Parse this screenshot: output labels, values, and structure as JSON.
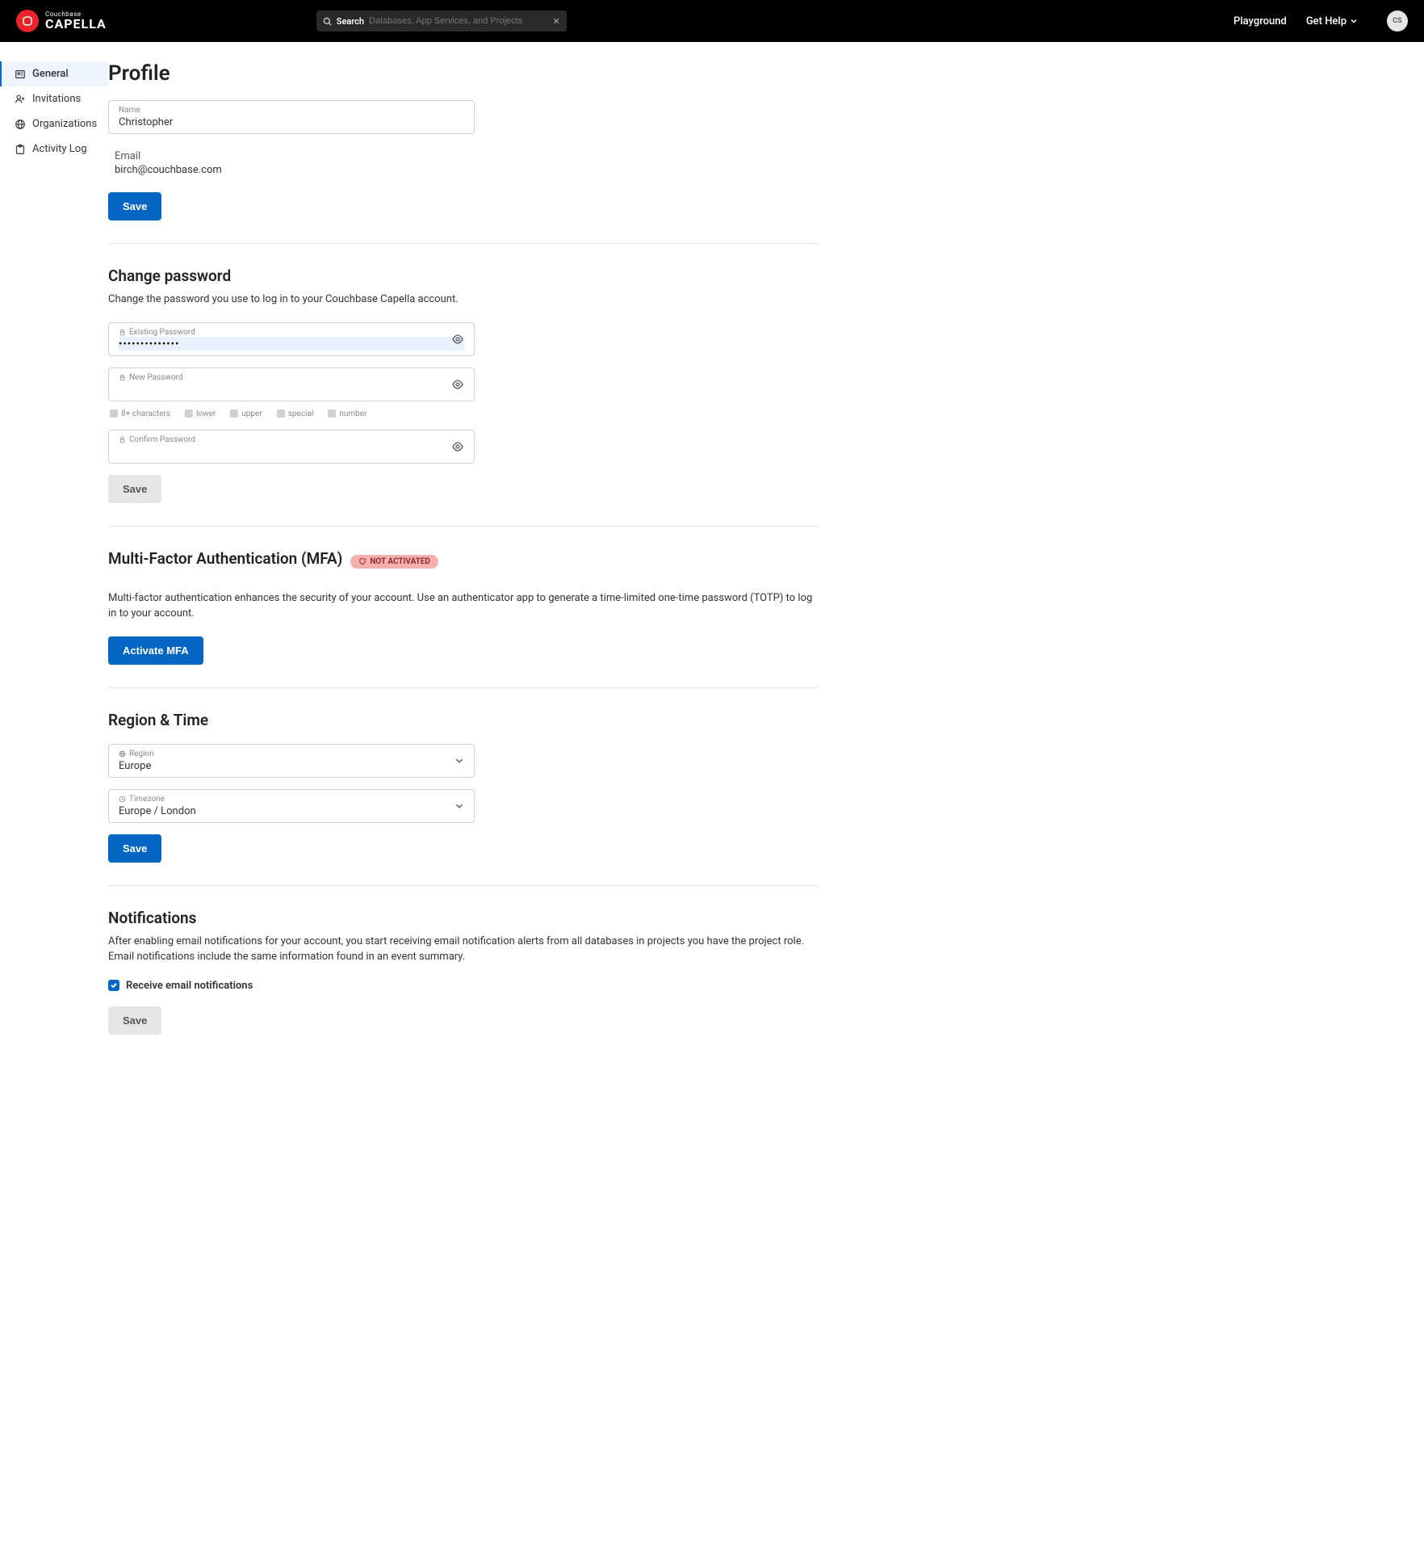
{
  "header": {
    "logo_small": "Couchbase",
    "logo_big": "CAPELLA",
    "search_label": "Search",
    "search_placeholder": "Databases, App Services, and Projects",
    "playground": "Playground",
    "get_help": "Get Help",
    "avatar_initials": "CS"
  },
  "sidebar": {
    "items": [
      {
        "label": "General",
        "active": true
      },
      {
        "label": "Invitations",
        "active": false
      },
      {
        "label": "Organizations",
        "active": false
      },
      {
        "label": "Activity Log",
        "active": false
      }
    ]
  },
  "profile": {
    "title": "Profile",
    "name_label": "Name",
    "name_value": "Christopher",
    "email_label": "Email",
    "email_value": "birch@couchbase.com",
    "save": "Save"
  },
  "password": {
    "title": "Change password",
    "desc": "Change the password you use to log in to your Couchbase Capella account.",
    "existing_label": "Existing Password",
    "existing_value": "••••••••••••••",
    "new_label": "New Password",
    "confirm_label": "Confirm Password",
    "reqs": [
      "8+ characters",
      "lower",
      "upper",
      "special",
      "number"
    ],
    "save": "Save"
  },
  "mfa": {
    "title": "Multi-Factor Authentication (MFA)",
    "badge": "NOT ACTIVATED",
    "desc": "Multi-factor authentication enhances the security of your account. Use an authenticator app to generate a time-limited one-time password (TOTP) to log in to your account.",
    "activate": "Activate MFA"
  },
  "region": {
    "title": "Region & Time",
    "region_label": "Region",
    "region_value": "Europe",
    "timezone_label": "Timezone",
    "timezone_value": "Europe / London",
    "save": "Save"
  },
  "notifications": {
    "title": "Notifications",
    "desc": "After enabling email notifications for your account, you start receiving email notification alerts from all databases in projects you have the project role. Email notifications include the same information found in an event summary.",
    "checkbox_label": "Receive email notifications",
    "checked": true,
    "save": "Save"
  }
}
